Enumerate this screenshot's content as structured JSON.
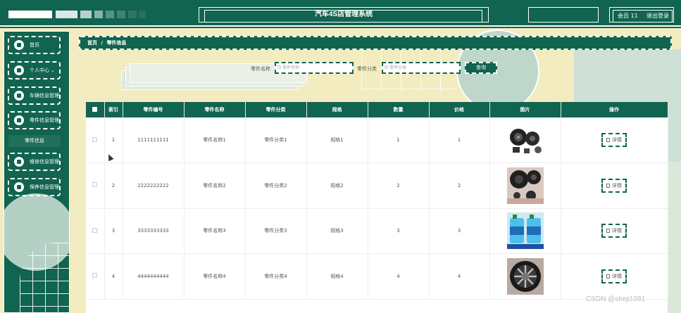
{
  "header": {
    "app_title": "汽车4S店管理系统",
    "user_name": "会员 11",
    "logout_label": "退出登录"
  },
  "sidebar": {
    "items": [
      {
        "label": "首页",
        "icon": "home-icon"
      },
      {
        "label": "个人中心",
        "icon": "user-icon",
        "has_chevron": true
      },
      {
        "label": "车辆信息管理",
        "icon": "grid-icon"
      },
      {
        "label": "零件信息管理",
        "icon": "car-icon"
      },
      {
        "label": "维修信息管理",
        "icon": "grid-icon"
      },
      {
        "label": "保养信息管理",
        "icon": "list-icon"
      }
    ],
    "sub_item": "零件信息"
  },
  "breadcrumb": {
    "home": "首页",
    "separator": "/",
    "current": "零件信息"
  },
  "search": {
    "name_label": "零件名称",
    "name_placeholder": "零件名称",
    "category_label": "零件分类",
    "category_placeholder": "零件分类",
    "button_label": "查询"
  },
  "table": {
    "headers": [
      "索引",
      "零件编号",
      "零件名称",
      "零件分类",
      "规格",
      "数量",
      "价格",
      "图片",
      "操作"
    ],
    "rows": [
      {
        "index": "1",
        "code": "1111111111",
        "name": "零件名称1",
        "category": "零件分类1",
        "spec": "规格1",
        "qty": "1",
        "price": "1",
        "image": "speaker-set-icon"
      },
      {
        "index": "2",
        "code": "2222222222",
        "name": "零件名称2",
        "category": "零件分类2",
        "spec": "规格2",
        "qty": "2",
        "price": "2",
        "image": "car-speaker-icon"
      },
      {
        "index": "3",
        "code": "3333333333",
        "name": "零件名称3",
        "category": "零件分类3",
        "spec": "规格3",
        "qty": "3",
        "price": "3",
        "image": "washer-fluid-icon"
      },
      {
        "index": "4",
        "code": "4444444444",
        "name": "零件名称4",
        "category": "零件分类4",
        "spec": "规格4",
        "qty": "4",
        "price": "4",
        "image": "wheel-rim-icon"
      }
    ],
    "action_label": "详情"
  },
  "watermark": "CSDN @sheji1081",
  "colors": {
    "primary": "#11644f",
    "background": "#f2ecc0",
    "accent_light": "#cfe0d6"
  }
}
